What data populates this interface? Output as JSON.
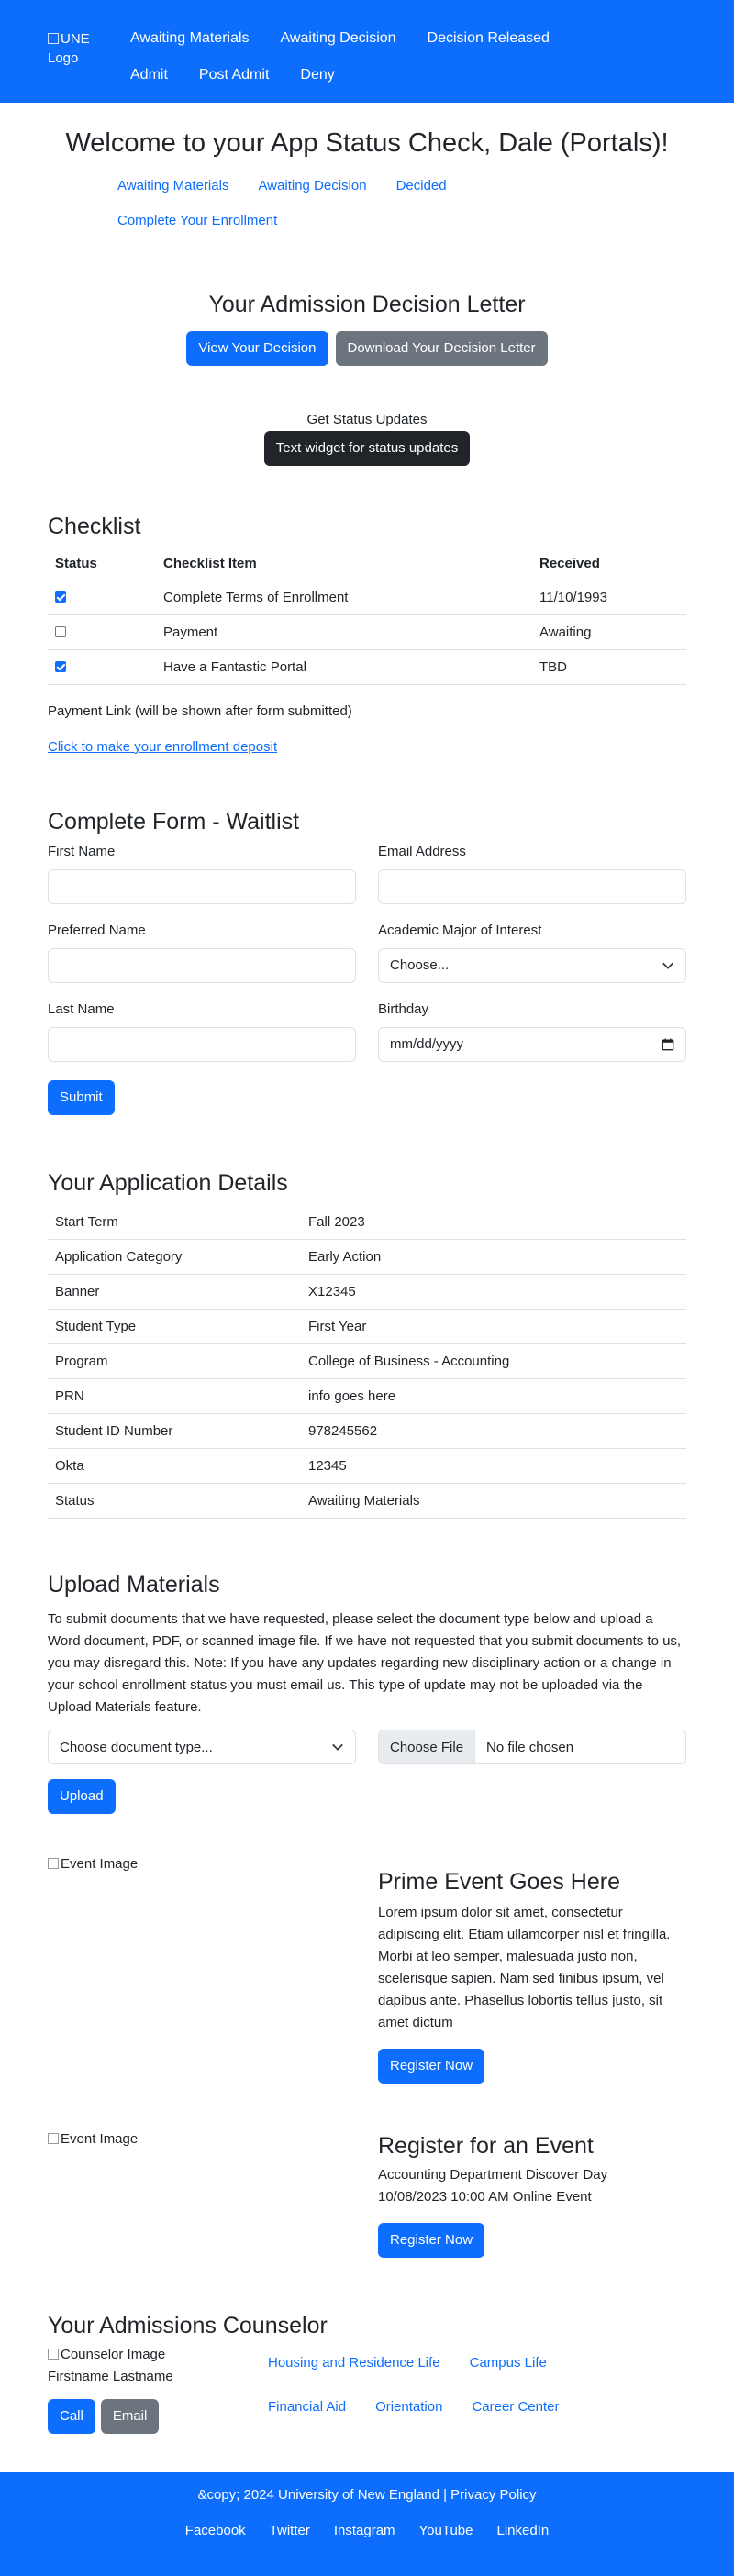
{
  "nav": {
    "logo_alt": "UNE Logo",
    "items": [
      "Awaiting Materials",
      "Awaiting Decision",
      "Decision Released",
      "Admit",
      "Post Admit",
      "Deny"
    ]
  },
  "welcome": "Welcome to your App Status Check, Dale (Portals)!",
  "subnav": [
    "Awaiting Materials",
    "Awaiting Decision",
    "Decided",
    "Complete Your Enrollment"
  ],
  "decision": {
    "title": "Your Admission Decision Letter",
    "view_label": "View Your Decision",
    "download_label": "Download Your Decision Letter"
  },
  "updates": {
    "label": "Get Status Updates",
    "button": "Text widget for status updates"
  },
  "checklist": {
    "title": "Checklist",
    "headers": [
      "Status",
      "Checklist Item",
      "Received"
    ],
    "rows": [
      {
        "checked": true,
        "item": "Complete Terms of Enrollment",
        "received": "11/10/1993"
      },
      {
        "checked": false,
        "item": "Payment",
        "received": "Awaiting"
      },
      {
        "checked": true,
        "item": "Have a Fantastic Portal",
        "received": "TBD"
      }
    ],
    "payment_note": "Payment Link (will be shown after form submitted)",
    "payment_link": "Click to make your enrollment deposit"
  },
  "form": {
    "title": "Complete Form - Waitlist",
    "first_name": "First Name",
    "email": "Email Address",
    "preferred_name": "Preferred Name",
    "major": "Academic Major of Interest",
    "major_selected": "Choose...",
    "last_name": "Last Name",
    "birthday": "Birthday",
    "birthday_placeholder": "mm/dd/yyyy",
    "submit": "Submit"
  },
  "details": {
    "title": "Your Application Details",
    "rows": [
      [
        "Start Term",
        "Fall 2023"
      ],
      [
        "Application Category",
        "Early Action"
      ],
      [
        "Banner",
        "X12345"
      ],
      [
        "Student Type",
        "First Year"
      ],
      [
        "Program",
        "College of Business - Accounting"
      ],
      [
        "PRN",
        "info goes here"
      ],
      [
        "Student ID Number",
        "978245562"
      ],
      [
        "Okta",
        "12345"
      ],
      [
        "Status",
        "Awaiting Materials"
      ]
    ]
  },
  "upload": {
    "title": "Upload Materials",
    "text": "To submit documents that we have requested, please select the document type below and upload a Word document, PDF, or scanned image file. If we have not requested that you submit documents to us, you may disregard this. Note: If you have any updates regarding new disciplinary action or a change in your school enrollment status you must email us. This type of update may not be uploaded via the Upload Materials feature.",
    "doc_type": "Choose document type...",
    "choose_file": "Choose File",
    "no_file": "No file chosen",
    "button": "Upload"
  },
  "events": [
    {
      "img_alt": "Event Image",
      "title": "Prime Event Goes Here",
      "text": "Lorem ipsum dolor sit amet, consectetur adipiscing elit. Etiam ullamcorper nisl et fringilla. Morbi at leo semper, malesuada justo non, scelerisque sapien. Nam sed finibus ipsum, vel dapibus ante. Phasellus lobortis tellus justo, sit amet dictum",
      "button": "Register Now"
    },
    {
      "img_alt": "Event Image",
      "title": "Register for an Event",
      "line1": "Accounting Department Discover Day",
      "line2": "10/08/2023 10:00 AM Online Event",
      "button": "Register Now"
    }
  ],
  "counselor": {
    "title": "Your Admissions Counselor",
    "img_alt": "Counselor Image",
    "name": "Firstname Lastname",
    "call": "Call",
    "email": "Email",
    "links": [
      "Housing and Residence Life",
      "Campus Life",
      "Financial Aid",
      "Orientation",
      "Career Center"
    ]
  },
  "footer": {
    "copy": "&copy; 2024 University of New England | Privacy Policy",
    "links": [
      "Facebook",
      "Twitter",
      "Instagram",
      "YouTube",
      "LinkedIn"
    ]
  },
  "colors": {
    "primary": "#0d6efd",
    "secondary": "#6c757d",
    "dark": "#212529"
  }
}
